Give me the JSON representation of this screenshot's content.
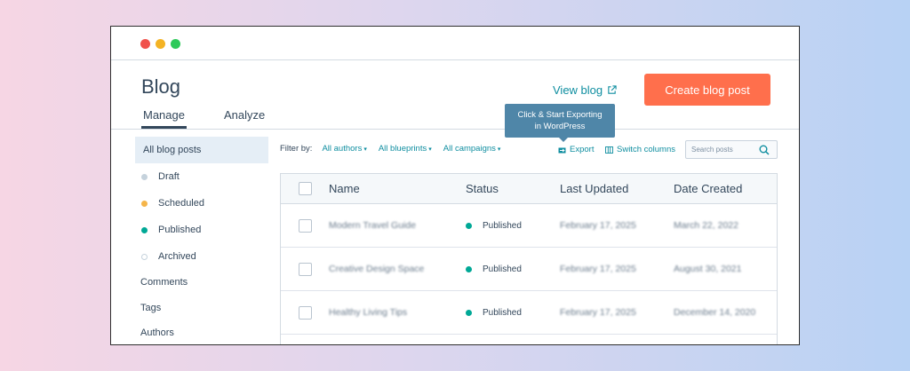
{
  "colors": {
    "accent": "#0f8ea0",
    "cta": "#ff6f4c",
    "draft": "#c5d2dc",
    "scheduled": "#f5b54a",
    "published": "#00a896",
    "archived": "#ffffff"
  },
  "header": {
    "title": "Blog",
    "view_blog": "View blog",
    "create_button": "Create blog post"
  },
  "tabs": [
    {
      "label": "Manage"
    },
    {
      "label": "Analyze"
    }
  ],
  "sidebar": {
    "items": [
      {
        "label": "All blog posts"
      },
      {
        "label": "Draft"
      },
      {
        "label": "Scheduled"
      },
      {
        "label": "Published"
      },
      {
        "label": "Archived"
      },
      {
        "label": "Comments"
      },
      {
        "label": "Tags"
      },
      {
        "label": "Authors"
      }
    ]
  },
  "filters": {
    "label": "Filter by:",
    "authors": "All authors",
    "blueprints": "All blueprints",
    "campaigns": "All campaigns"
  },
  "tooltip": {
    "line1": "Click & Start Exporting",
    "line2": "in WordPress"
  },
  "toolbar": {
    "export": "Export",
    "switch_columns": "Switch columns",
    "search_placeholder": "Search posts"
  },
  "table": {
    "columns": [
      "Name",
      "Status",
      "Last Updated",
      "Date Created"
    ],
    "rows": [
      {
        "name": "Modern Travel Guide",
        "status": "Published",
        "updated": "February 17, 2025",
        "created": "March 22, 2022"
      },
      {
        "name": "Creative Design Space",
        "status": "Published",
        "updated": "February 17, 2025",
        "created": "August 30, 2021"
      },
      {
        "name": "Healthy Living Tips",
        "status": "Published",
        "updated": "February 17, 2025",
        "created": "December 14, 2020"
      }
    ]
  }
}
